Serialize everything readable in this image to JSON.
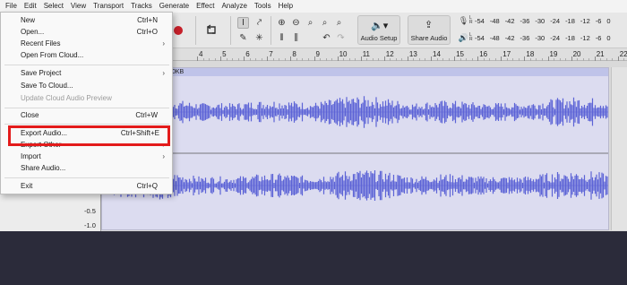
{
  "menubar": {
    "items": [
      "File",
      "Edit",
      "Select",
      "View",
      "Transport",
      "Tracks",
      "Generate",
      "Effect",
      "Analyze",
      "Tools",
      "Help"
    ]
  },
  "toolbar": {
    "audio_setup_label": "Audio Setup",
    "share_audio_label": "Share Audio",
    "meter_scale": [
      "-54",
      "-48",
      "-42",
      "-36",
      "-30",
      "-24",
      "-18",
      "-12",
      "-6",
      "0"
    ],
    "meter_channels": [
      "L",
      "R"
    ],
    "record_color": "#c6202a"
  },
  "ruler": {
    "labels": [
      "4",
      "5",
      "6",
      "7",
      "8",
      "9",
      "10",
      "11",
      "12",
      "13",
      "14",
      "15",
      "16",
      "17",
      "18",
      "19",
      "20",
      "21",
      "22"
    ]
  },
  "track": {
    "clip_title": "0KB",
    "amplitude_labels": [
      "-0.5",
      "-1.0"
    ],
    "waveform_color": "#5c63d6",
    "clip_color": "#dcdcf0"
  },
  "file_menu": {
    "items": [
      {
        "label": "New",
        "shortcut": "Ctrl+N"
      },
      {
        "label": "Open...",
        "shortcut": "Ctrl+O"
      },
      {
        "label": "Recent Files",
        "submenu": true
      },
      {
        "label": "Open From Cloud..."
      },
      {
        "label": "Save Project",
        "submenu": true
      },
      {
        "label": "Save To Cloud..."
      },
      {
        "label": "Update Cloud Audio Preview",
        "disabled": true
      },
      {
        "label": "Close",
        "shortcut": "Ctrl+W"
      },
      {
        "label": "Export Audio...",
        "shortcut": "Ctrl+Shift+E"
      },
      {
        "label": "Export Other",
        "submenu": true
      },
      {
        "label": "Import",
        "submenu": true
      },
      {
        "label": "Share Audio..."
      },
      {
        "label": "Exit",
        "shortcut": "Ctrl+Q"
      }
    ],
    "highlight_color": "#e31b1b"
  }
}
